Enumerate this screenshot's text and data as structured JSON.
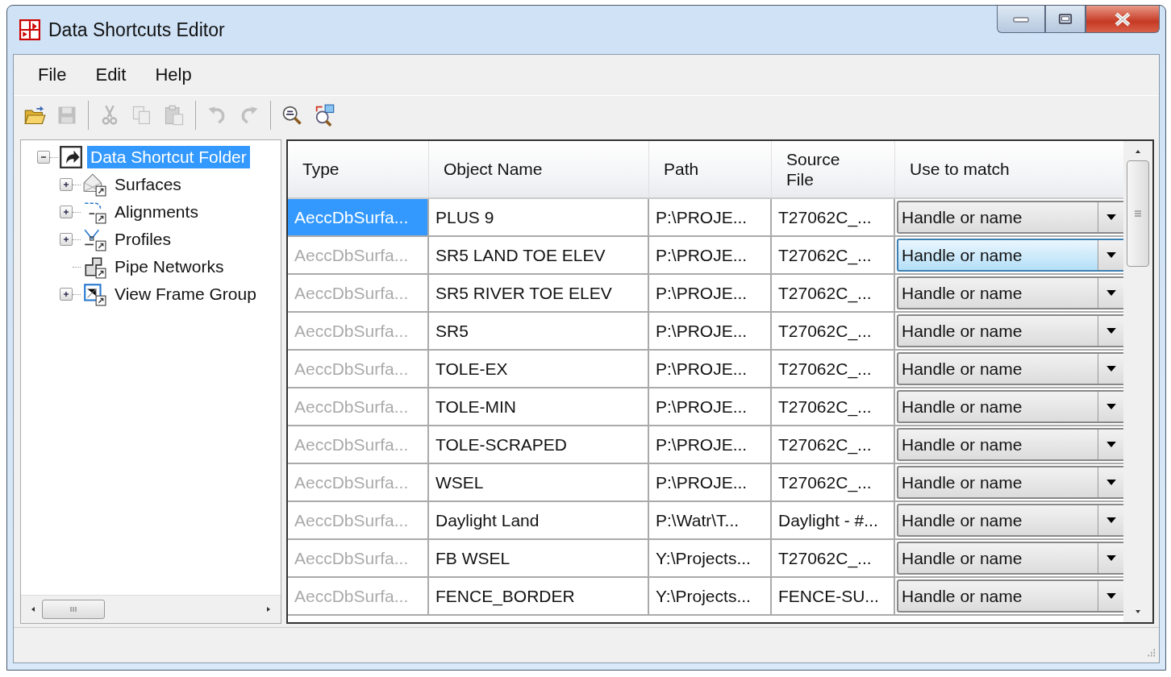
{
  "window": {
    "title": "Data Shortcuts Editor"
  },
  "menu": [
    "File",
    "Edit",
    "Help"
  ],
  "toolbar": [
    {
      "kind": "open",
      "disabled": false
    },
    {
      "kind": "save",
      "disabled": true
    },
    {
      "kind": "separator"
    },
    {
      "kind": "cut",
      "disabled": true
    },
    {
      "kind": "copy",
      "disabled": true
    },
    {
      "kind": "paste",
      "disabled": true
    },
    {
      "kind": "separator"
    },
    {
      "kind": "undo",
      "disabled": true
    },
    {
      "kind": "redo",
      "disabled": true
    },
    {
      "kind": "separator"
    },
    {
      "kind": "find",
      "disabled": false
    },
    {
      "kind": "find-replace",
      "disabled": false
    }
  ],
  "tree": {
    "label": "Data Shortcut Folder",
    "expanded": true,
    "selected": true,
    "children": [
      {
        "label": "Surfaces",
        "kind": "surface",
        "expandable": true,
        "selected": false
      },
      {
        "label": "Alignments",
        "kind": "alignment",
        "expandable": true,
        "selected": false
      },
      {
        "label": "Profiles",
        "kind": "profile",
        "expandable": true,
        "selected": false
      },
      {
        "label": "Pipe Networks",
        "kind": "pipe",
        "expandable": false,
        "selected": false
      },
      {
        "label": "View Frame Group",
        "kind": "viewframe",
        "expandable": true,
        "selected": false
      }
    ]
  },
  "table": {
    "columns": [
      "Type",
      "Object Name",
      "Path",
      "Source\nFile",
      "Use to match"
    ],
    "rows": [
      {
        "type": "AeccDbSurfa...",
        "name": "PLUS 9",
        "path": "P:\\PROJE...",
        "source": "T27062C_...",
        "match": "Handle or name",
        "selected": true,
        "focused": false
      },
      {
        "type": "AeccDbSurfa...",
        "name": "SR5 LAND TOE ELEV",
        "path": "P:\\PROJE...",
        "source": "T27062C_...",
        "match": "Handle or name",
        "selected": false,
        "focused": true
      },
      {
        "type": "AeccDbSurfa...",
        "name": "SR5 RIVER TOE ELEV",
        "path": "P:\\PROJE...",
        "source": "T27062C_...",
        "match": "Handle or name",
        "selected": false,
        "focused": false
      },
      {
        "type": "AeccDbSurfa...",
        "name": "SR5",
        "path": "P:\\PROJE...",
        "source": "T27062C_...",
        "match": "Handle or name",
        "selected": false,
        "focused": false
      },
      {
        "type": "AeccDbSurfa...",
        "name": "TOLE-EX",
        "path": "P:\\PROJE...",
        "source": "T27062C_...",
        "match": "Handle or name",
        "selected": false,
        "focused": false
      },
      {
        "type": "AeccDbSurfa...",
        "name": "TOLE-MIN",
        "path": "P:\\PROJE...",
        "source": "T27062C_...",
        "match": "Handle or name",
        "selected": false,
        "focused": false
      },
      {
        "type": "AeccDbSurfa...",
        "name": "TOLE-SCRAPED",
        "path": "P:\\PROJE...",
        "source": "T27062C_...",
        "match": "Handle or name",
        "selected": false,
        "focused": false
      },
      {
        "type": "AeccDbSurfa...",
        "name": "WSEL",
        "path": "P:\\PROJE...",
        "source": "T27062C_...",
        "match": "Handle or name",
        "selected": false,
        "focused": false
      },
      {
        "type": "AeccDbSurfa...",
        "name": "Daylight Land",
        "path": "P:\\Watr\\T...",
        "source": "Daylight - #...",
        "match": "Handle or name",
        "selected": false,
        "focused": false
      },
      {
        "type": "AeccDbSurfa...",
        "name": "FB WSEL",
        "path": "Y:\\Projects...",
        "source": "T27062C_...",
        "match": "Handle or name",
        "selected": false,
        "focused": false
      },
      {
        "type": "AeccDbSurfa...",
        "name": "FENCE_BORDER",
        "path": "Y:\\Projects...",
        "source": "FENCE-SU...",
        "match": "Handle or name",
        "selected": false,
        "focused": false
      }
    ]
  }
}
